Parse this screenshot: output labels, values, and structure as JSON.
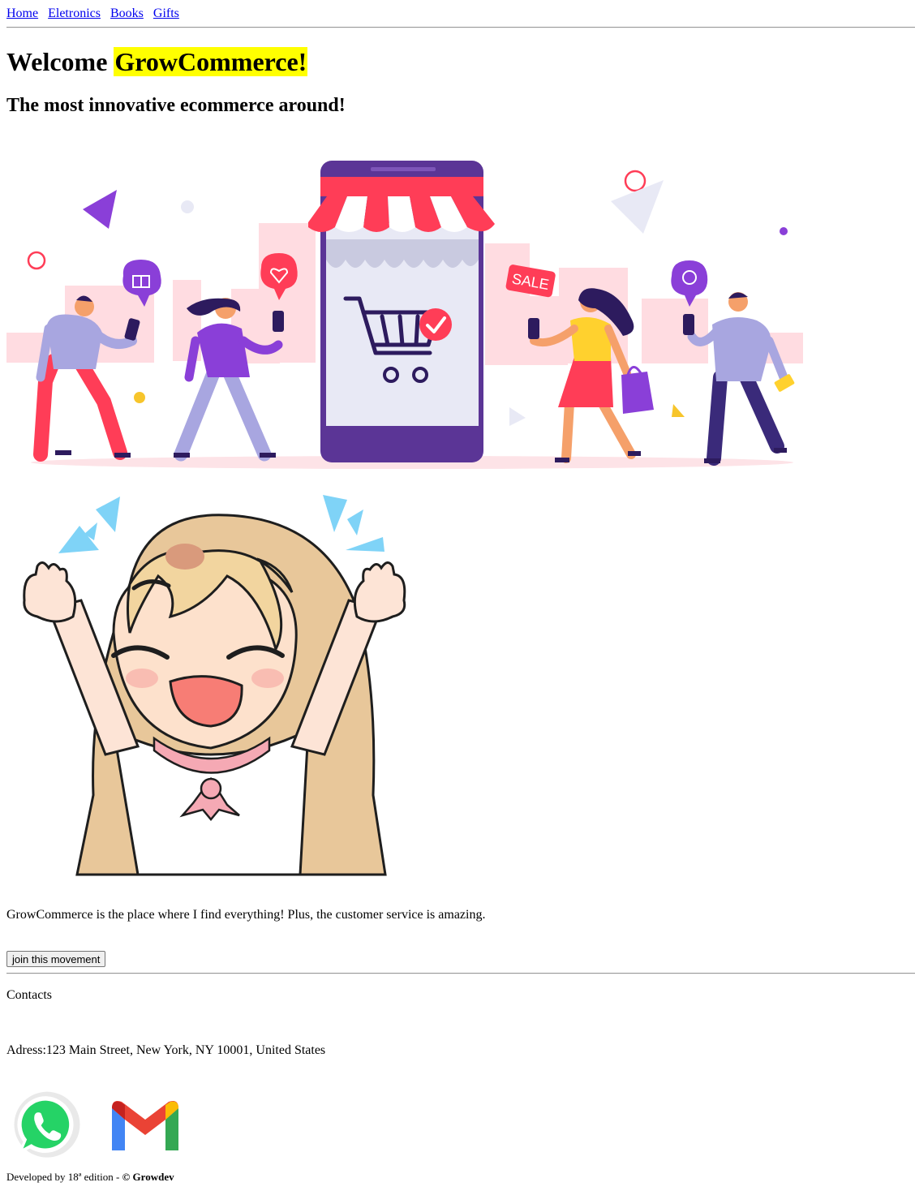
{
  "nav": {
    "links": [
      "Home",
      "Eletronics",
      "Books",
      "Gifts"
    ]
  },
  "header": {
    "welcome": "Welcome ",
    "brand": "GrowCommerce!",
    "subtitle": "The most innovative ecommerce around!"
  },
  "hero": {
    "sale_badge": "SALE"
  },
  "testimonial": {
    "quote": "GrowCommerce is the place where I find everything! Plus, the customer service is amazing.",
    "cta_label": "join this movement"
  },
  "contacts": {
    "heading": "Contacts",
    "address": "Adress:123 Main Street, New York, NY 10001, United States"
  },
  "footer": {
    "developed": "Developed by 18ª edition - ",
    "copyright": "© Growdev"
  },
  "colors": {
    "highlight": "#ffff00",
    "link": "#0000ee",
    "awning_red": "#ff3d57",
    "phone_purple": "#5b3596",
    "whatsapp_green": "#25d366"
  }
}
